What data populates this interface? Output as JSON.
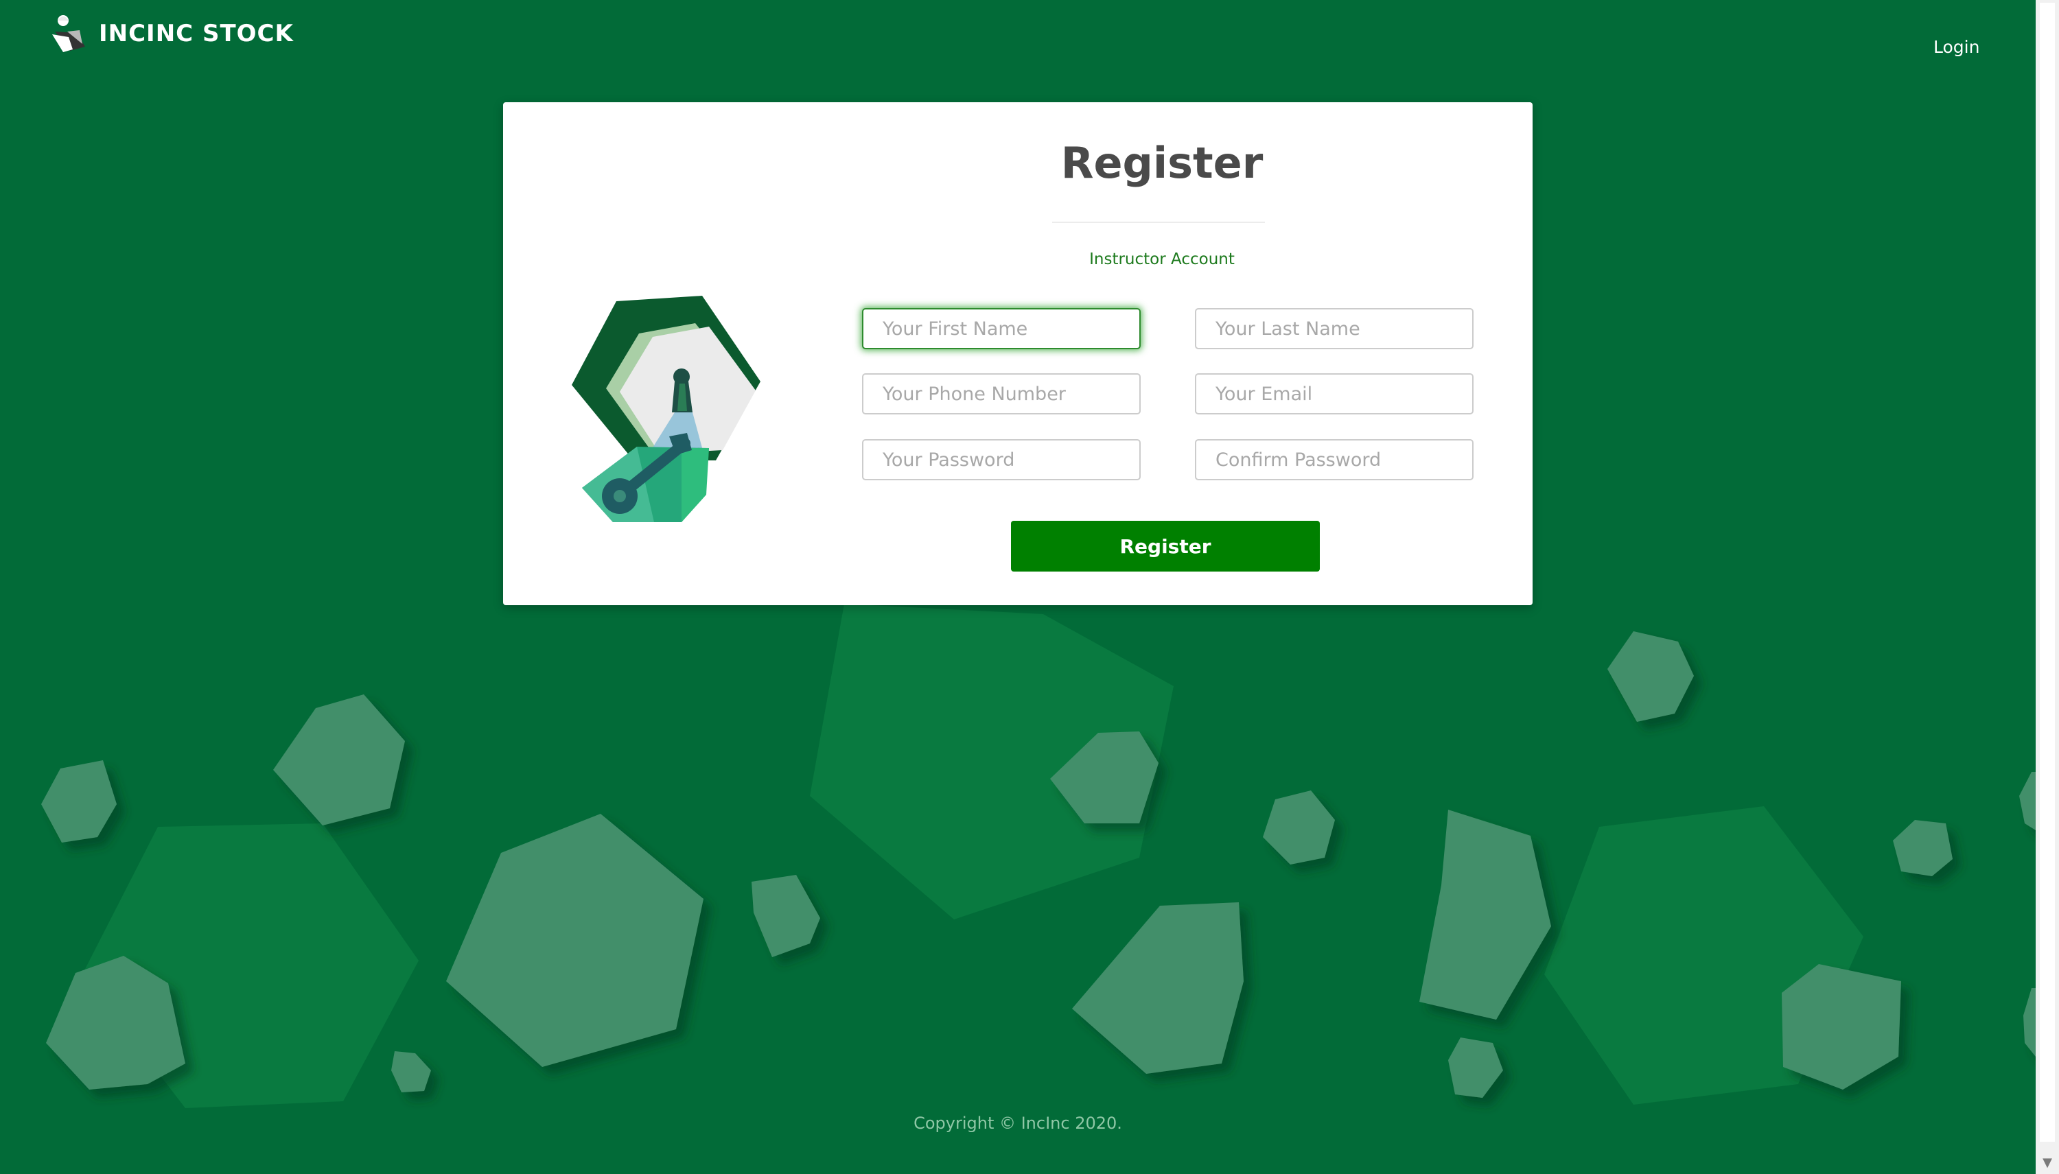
{
  "header": {
    "brand_name": "INCINC STOCK",
    "login_label": "Login"
  },
  "card": {
    "title": "Register",
    "account_type": "Instructor Account",
    "fields": {
      "first_name_placeholder": "Your First Name",
      "last_name_placeholder": "Your Last Name",
      "phone_placeholder": "Your Phone Number",
      "email_placeholder": "Your Email",
      "password_placeholder": "Your Password",
      "confirm_password_placeholder": "Confirm Password"
    },
    "register_button_label": "Register"
  },
  "footer": {
    "copyright": "Copyright © IncInc 2020."
  },
  "colors": {
    "background": "#026b38",
    "primary_button": "#008000",
    "account_type_text": "#1d7a1d"
  },
  "icons": {
    "brand": "brand-logo-icon",
    "illustration": "key-lock-illustration-icon"
  }
}
